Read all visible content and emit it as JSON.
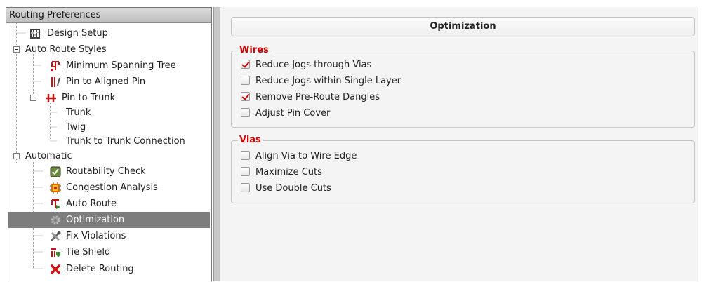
{
  "left_panel": {
    "header": "Routing Preferences",
    "items": [
      {
        "label": "Design Setup",
        "icon": "design-setup-icon"
      },
      {
        "label": "Auto Route Styles",
        "icon": ""
      },
      {
        "label": "Minimum Spanning Tree",
        "icon": "spanning-tree-icon"
      },
      {
        "label": "Pin to Aligned Pin",
        "icon": "aligned-pin-icon"
      },
      {
        "label": "Pin to Trunk",
        "icon": "pin-to-trunk-icon"
      },
      {
        "label": "Trunk",
        "icon": ""
      },
      {
        "label": "Twig",
        "icon": ""
      },
      {
        "label": "Trunk to Trunk Connection",
        "icon": ""
      },
      {
        "label": "Automatic",
        "icon": ""
      },
      {
        "label": "Routability Check",
        "icon": "routability-check-icon"
      },
      {
        "label": "Congestion Analysis",
        "icon": "congestion-analysis-icon"
      },
      {
        "label": "Auto Route",
        "icon": "auto-route-icon"
      },
      {
        "label": "Optimization",
        "icon": "optimization-icon"
      },
      {
        "label": "Fix Violations",
        "icon": "fix-violations-icon"
      },
      {
        "label": "Tie Shield",
        "icon": "tie-shield-icon"
      },
      {
        "label": "Delete Routing",
        "icon": "delete-routing-icon"
      }
    ],
    "selected": "Optimization"
  },
  "right_panel": {
    "title": "Optimization",
    "wires": {
      "legend": "Wires",
      "options": [
        {
          "label": "Reduce Jogs through Vias",
          "checked": true
        },
        {
          "label": "Reduce Jogs within Single Layer",
          "checked": false
        },
        {
          "label": "Remove Pre-Route Dangles",
          "checked": true
        },
        {
          "label": "Adjust Pin Cover",
          "checked": false
        }
      ]
    },
    "vias": {
      "legend": "Vias",
      "options": [
        {
          "label": "Align Via to Wire Edge",
          "checked": false
        },
        {
          "label": "Maximize Cuts",
          "checked": false
        },
        {
          "label": "Use Double Cuts",
          "checked": false
        }
      ]
    }
  },
  "colors": {
    "legend_red": "#d00000",
    "checkmark_red": "#d10000",
    "selection_gray": "#7d7d7d"
  }
}
